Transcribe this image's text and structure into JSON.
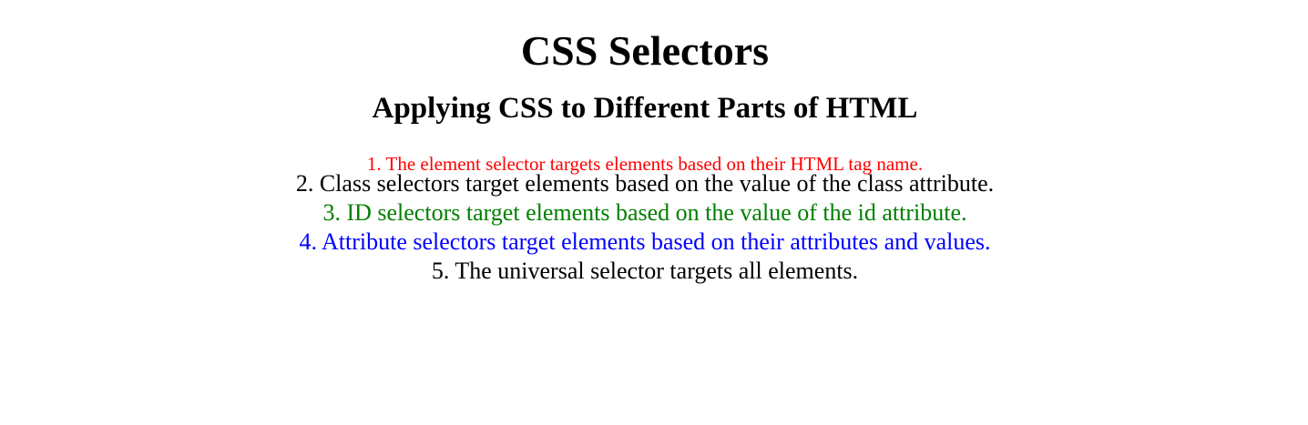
{
  "heading": "CSS Selectors",
  "subheading": "Applying CSS to Different Parts of HTML",
  "items": [
    {
      "text": "1. The element selector targets elements based on their HTML tag name.",
      "color": "#ff0000"
    },
    {
      "text": "2. Class selectors target elements based on the value of the class attribute.",
      "color": "#000000"
    },
    {
      "text": "3. ID selectors target elements based on the value of the id attribute.",
      "color": "#008000"
    },
    {
      "text": "4. Attribute selectors target elements based on their attributes and values.",
      "color": "#0000ff"
    },
    {
      "text": "5. The universal selector targets all elements.",
      "color": "#000000"
    }
  ]
}
